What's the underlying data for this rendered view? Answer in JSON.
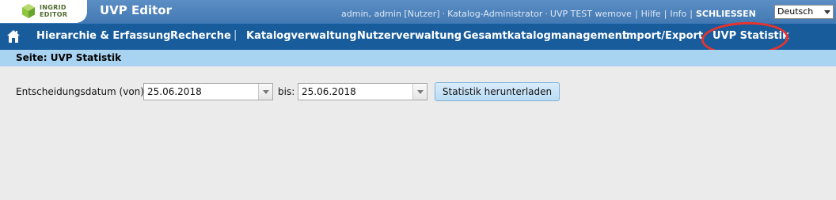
{
  "header": {
    "logo_line1": "INGRID",
    "logo_line2": "EDITOR",
    "app_title": "UVP Editor",
    "user": "admin, admin [Nutzer]",
    "role": "Katalog-Administrator",
    "catalog": "UVP TEST wemove",
    "help": "Hilfe",
    "info": "Info",
    "close": "SCHLIESSEN",
    "language": "Deutsch"
  },
  "nav": {
    "items": [
      "Hierarchie & Erfassung",
      "Recherche",
      "Katalogverwaltung",
      "Nutzerverwaltung",
      "Gesamtkatalogmanagement",
      "Import/Export",
      "UVP Statistik"
    ],
    "separator": "|"
  },
  "page": {
    "title": "Seite: UVP Statistik"
  },
  "form": {
    "from_label": "Entscheidungsdatum (von):",
    "from_value": "25.06.2018",
    "to_label": "bis:",
    "to_value": "25.06.2018",
    "download_label": "Statistik herunterladen"
  },
  "colors": {
    "header": "#4479b3",
    "nav": "#185c9c",
    "page_bar": "#a8d4f2",
    "annotation": "#e8332f"
  }
}
